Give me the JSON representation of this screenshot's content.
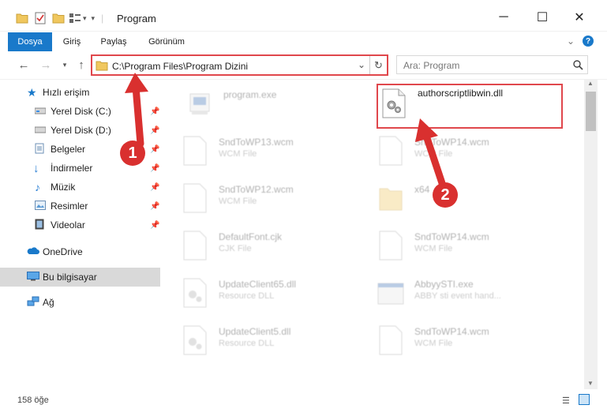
{
  "window": {
    "title": "Program"
  },
  "ribbon": {
    "tabs": [
      "Dosya",
      "Giriş",
      "Paylaş",
      "Görünüm"
    ]
  },
  "address": {
    "path": "C:\\Program Files\\Program Dizini"
  },
  "search": {
    "placeholder": "Ara: Program"
  },
  "sidebar": {
    "items": [
      {
        "label": "Hızlı erişim"
      },
      {
        "label": "Yerel Disk (C:)"
      },
      {
        "label": "Yerel Disk (D:)"
      },
      {
        "label": "Belgeler"
      },
      {
        "label": "İndirmeler"
      },
      {
        "label": "Müzik"
      },
      {
        "label": "Resimler"
      },
      {
        "label": "Videolar"
      },
      {
        "label": "OneDrive"
      },
      {
        "label": "Bu bilgisayar"
      },
      {
        "label": "Ağ"
      }
    ]
  },
  "files": [
    {
      "name": "program.exe",
      "type": ""
    },
    {
      "name": "authorscriptlibwin.dll",
      "type": ""
    },
    {
      "name": "SndToWP13.wcm",
      "type": "WCM File"
    },
    {
      "name": "SndToWP14.wcm",
      "type": "WCM File"
    },
    {
      "name": "SndToWP12.wcm",
      "type": "WCM File"
    },
    {
      "name": "x64",
      "type": ""
    },
    {
      "name": "DefaultFont.cjk",
      "type": "CJK File"
    },
    {
      "name": "SndToWP14.wcm",
      "type": "WCM File"
    },
    {
      "name": "UpdateClient65.dll",
      "type": "Resource DLL"
    },
    {
      "name": "AbbyySTI.exe",
      "type": "ABBY sti event hand..."
    },
    {
      "name": "UpdateClient5.dll",
      "type": "Resource DLL"
    },
    {
      "name": "SndToWP14.wcm",
      "type": "WCM File"
    }
  ],
  "annotations": {
    "marker1": "1",
    "marker2": "2",
    "color": "#d9302f"
  },
  "status": {
    "count": "158 öğe"
  },
  "colors": {
    "accent": "#1979ca",
    "highlight": "#e0474c"
  }
}
